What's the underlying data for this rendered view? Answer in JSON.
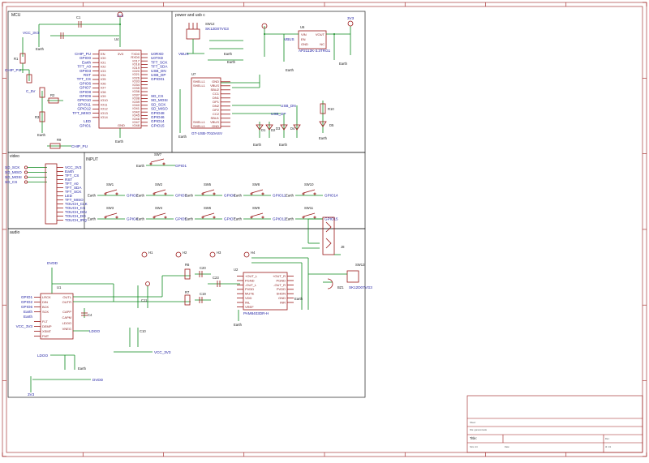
{
  "sections": {
    "mcu": "MCU",
    "power": "power and usb c",
    "video": "video",
    "input": "INPUT",
    "audio": "audio"
  },
  "mcu": {
    "u4_ref": "U4",
    "u4_vdd": "3V3",
    "u4_gnd": "GND",
    "u4_left_pins": [
      "EN",
      "IO0",
      "IO1",
      "IO2",
      "IO3",
      "IO4",
      "IO5",
      "IO6",
      "IO7",
      "IO8",
      "IO9",
      "IO10",
      "IO11",
      "IO12",
      "IO13",
      "IO14"
    ],
    "u4_right_pins": [
      "TXD0",
      "RXD0",
      "IO17",
      "IO18",
      "IO19",
      "IO20",
      "IO21",
      "IO26",
      "IO33",
      "IO34",
      "IO35",
      "IO36",
      "IO37",
      "IO38",
      "IO39",
      "IO40",
      "IO41",
      "IO42",
      "IO45",
      "IO46",
      "IO47",
      "IO48"
    ],
    "left_nets": [
      "CHIP_PU",
      "GPIO0",
      "Earth",
      "TFT_A0",
      "GPIO3",
      "RST",
      "TFT_CS",
      "GPIO6",
      "GPIO7",
      "GPIO8",
      "GPIO9",
      "GPIO10",
      "GPIO11",
      "GPIO12",
      "TFT_MISO",
      "",
      "LED",
      "GPIO1"
    ],
    "right_nets": [
      "U0RXD",
      "U0TXD",
      "TFT_SCK",
      "TFT_SDA",
      "USB_DN",
      "USB_DP",
      "GPIO01",
      "",
      "",
      "",
      "SD_CS",
      "SD_MOSI",
      "SD_SCK",
      "SD_MISO",
      "GPIO48",
      "GPIO46",
      "GPIO14",
      "GPIO15"
    ],
    "c1": "C1",
    "vcc": "VCC_3V3",
    "r1": "R1",
    "r2": "R2",
    "r3": "R3",
    "r9": "R9",
    "chip_pu": "CHIP_PU",
    "earth": "Earth",
    "c5v": "C_5V",
    "vdd": "3V3"
  },
  "power": {
    "sw12": "SW12",
    "sw12_part": "SK12D07VG3",
    "vbus": "VBUS",
    "earth": "Earth",
    "u6": "U6",
    "u6_part": "AP2112K-3.3TRG1",
    "u6_pins_l": [
      "VIN",
      "EN",
      "GND"
    ],
    "u6_pins_r": [
      "VOUT",
      "NC"
    ],
    "vdd": "3V3",
    "u7": "U7",
    "u7_part": "GT-USB-7010ASV",
    "u7_pins_l": [
      "SHELL1",
      "SHELL1",
      "",
      "",
      "",
      "",
      "",
      "",
      "",
      "",
      "SHELL1",
      "SHELL1"
    ],
    "u7_pins_m": [
      "GND",
      "VBUS",
      "SBU2",
      "CC1",
      "DN1",
      "DP1",
      "DN2",
      "DP2",
      "CC2",
      "SBU1",
      "VBUS",
      "GND"
    ],
    "usb_nets": [
      "USB_DN",
      "USB_DP"
    ],
    "r10": "R10",
    "d3": "D3",
    "d4": "D4",
    "d5": "D5",
    "d1": "D1",
    "d2": "D2"
  },
  "video": {
    "j1_nets_left": [
      "SD_SCK",
      "SD_MISO",
      "SD_MOSI",
      "SD_CS"
    ],
    "j1_nets_right": [
      "VCC_3V3",
      "Earth",
      "TFT_CS",
      "RST",
      "TFT_A0",
      "TFT_SDA",
      "TFT_SCK",
      "LED",
      "TFT_MISO",
      "TOUCH_CLK",
      "TOUCH_CS",
      "TOUCH_DIN",
      "TOUCH_DO",
      "TOUCH_IRQ"
    ]
  },
  "input": {
    "sw7": "SW7",
    "sw7_net": "GPIO1",
    "rows": [
      [
        {
          "ref": "SW1",
          "net": "GPIO2"
        },
        {
          "ref": "SW2",
          "net": "GPIO3"
        },
        {
          "ref": "SW5",
          "net": "GPIO6"
        },
        {
          "ref": "SW8",
          "net": "GPIO11"
        },
        {
          "ref": "SW10",
          "net": "GPIO14"
        }
      ],
      [
        {
          "ref": "SW3",
          "net": "GPIO4"
        },
        {
          "ref": "SW4",
          "net": "GPIO5"
        },
        {
          "ref": "SW6",
          "net": "GPIO7"
        },
        {
          "ref": "SW9",
          "net": "GPIO12"
        },
        {
          "ref": "SW11",
          "net": "GPIO15"
        }
      ]
    ],
    "earth": "Earth"
  },
  "audio": {
    "holes": [
      "H1",
      "H2",
      "H3",
      "H4"
    ],
    "u1": "U1",
    "u1_pins_l": [
      "LRCK",
      "DIN",
      "BCK",
      "SCK",
      "",
      "FLT",
      "DEMP",
      "XSMT",
      "FMT"
    ],
    "u1_pins_r": [
      "OUTL",
      "OUTR",
      "CAPP",
      "CAPM",
      "LDOO",
      "VNEG"
    ],
    "u1_nets": [
      "GPIO1",
      "GPIO2",
      "GPIO6",
      "Earth",
      "Earth",
      "VCC_3V3"
    ],
    "dvdd": "DVDD",
    "ldoo": "LDOO",
    "vcc": "VCC_3V3",
    "u2": "U2",
    "u2_part": "PAM8403DR-H",
    "u2_pins_l": [
      "+OUT_L",
      "PGND",
      "-OUT_L",
      "PVDD",
      "MUTE",
      "VDD",
      "INL",
      "VREF"
    ],
    "u2_pins_r": [
      "+OUT_R",
      "PGND",
      "-OUT_R",
      "PVDD",
      "SHDN",
      "GND",
      "INR"
    ],
    "r6": "R6",
    "r7": "R7",
    "c20": "C20",
    "c19": "C19",
    "c23": "C23",
    "c4": "C4",
    "c10": "C10",
    "c11": "C11",
    "j8": "J8",
    "sw13": "SW13",
    "sw13_part": "SK12D07VG3",
    "bz1": "BZ1",
    "earth": "Earth",
    "vdd": "3V3"
  },
  "titleblock": {
    "sheet_label": "Sheet:",
    "file_label": "File: gameconsole",
    "title_label": "Title:",
    "size_label": "Size: A4",
    "date_label": "Date:",
    "rev_label": "Rev:",
    "id_label": "Id: 1/1"
  }
}
